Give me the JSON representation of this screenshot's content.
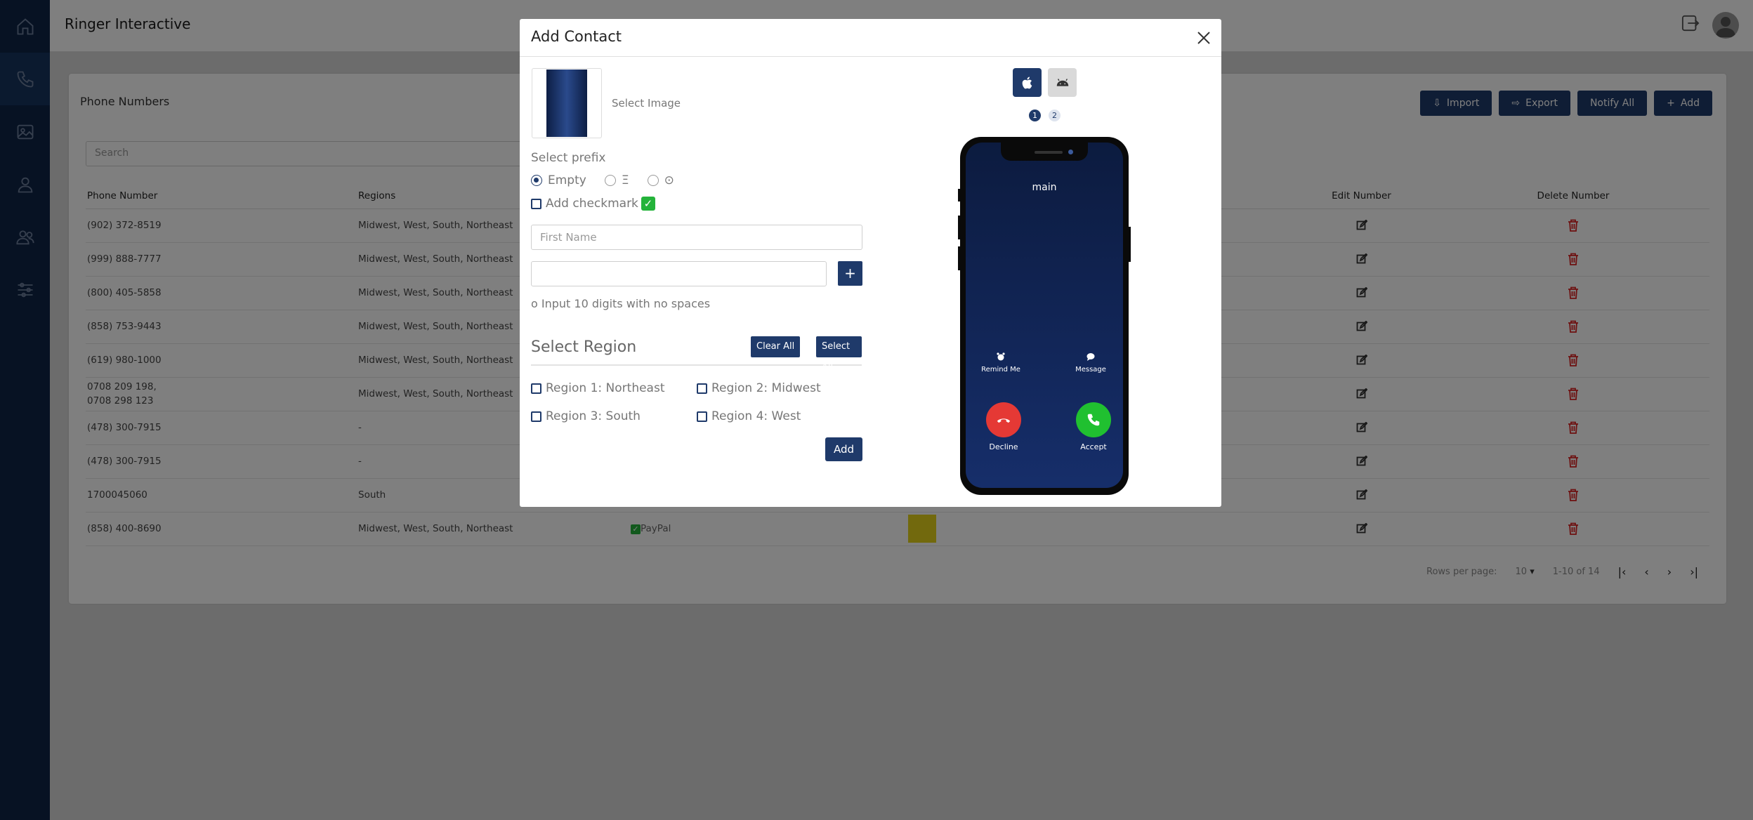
{
  "app": {
    "title": "Ringer Interactive"
  },
  "sidebar": {
    "items": [
      {
        "icon": "home-icon"
      },
      {
        "icon": "phone-icon",
        "active": true
      },
      {
        "icon": "image-icon"
      },
      {
        "icon": "user-icon"
      },
      {
        "icon": "users-icon"
      },
      {
        "icon": "sliders-icon"
      }
    ]
  },
  "page": {
    "title": "Phone Numbers",
    "search_placeholder": "Search",
    "actions": {
      "import": "Import",
      "export": "Export",
      "notify_all": "Notify All",
      "add": "Add"
    },
    "table": {
      "headers": {
        "phone": "Phone Number",
        "regions": "Regions",
        "edit": "Edit Number",
        "delete": "Delete Number"
      },
      "rows": [
        {
          "phone": "(902) 372-8519",
          "regions": "Midwest, West, South, Northeast"
        },
        {
          "phone": "(999) 888-7777",
          "regions": "Midwest, West, South, Northeast"
        },
        {
          "phone": "(800) 405-5858",
          "regions": "Midwest, West, South, Northeast"
        },
        {
          "phone": "(858) 753-9443",
          "regions": "Midwest, West, South, Northeast"
        },
        {
          "phone": "(619) 980-1000",
          "regions": "Midwest, West, South, Northeast"
        },
        {
          "phone": "0708 209 198,",
          "phone2": "0708 298 123",
          "regions": "Midwest, West, South, Northeast"
        },
        {
          "phone": "(478) 300-7915",
          "regions": "-"
        },
        {
          "phone": "(478) 300-7915",
          "regions": "-"
        },
        {
          "phone": "1700045060",
          "regions": "South"
        },
        {
          "phone": "(858) 400-8690",
          "regions": "Midwest, West, South, Northeast",
          "company": "PayPal"
        }
      ]
    },
    "pagination": {
      "rows_per_page_label": "Rows per page:",
      "rows_per_page": "10",
      "range": "1-10 of 14"
    }
  },
  "modal": {
    "title": "Add Contact",
    "select_image": "Select Image",
    "prefix_label": "Select prefix",
    "prefix_options": [
      "Empty",
      "Ξ",
      "⊙"
    ],
    "prefix_selected": "Empty",
    "add_checkmark": "Add checkmark",
    "first_name_placeholder": "First Name",
    "phone_value": "",
    "hint": "Input 10 digits with no spaces",
    "hint_bullet": "o",
    "region_title": "Select Region",
    "clear_all": "Clear All",
    "select_all": "Select All",
    "regions": [
      "Region 1: Northeast",
      "Region 2: Midwest",
      "Region 3: South",
      "Region 4: West"
    ],
    "add_button": "Add",
    "preview": {
      "steps": [
        "1",
        "2"
      ],
      "caller": "main",
      "remind_me": "Remind Me",
      "message": "Message",
      "decline": "Decline",
      "accept": "Accept"
    }
  }
}
